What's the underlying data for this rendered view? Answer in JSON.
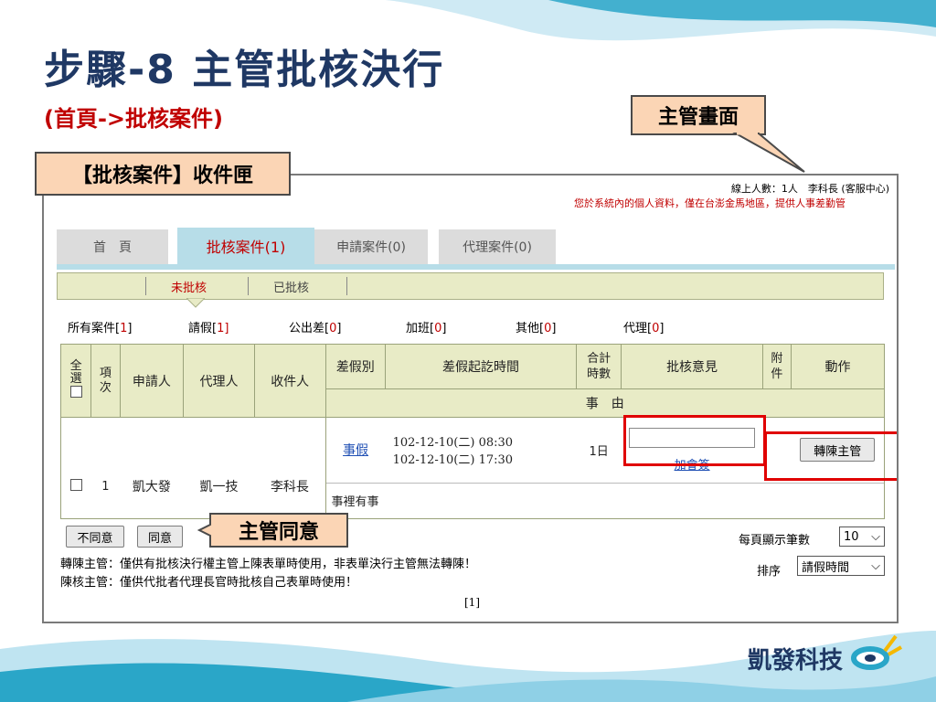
{
  "slide": {
    "title": "步驟-8 主管批核決行",
    "subtitle": "(首頁->批核案件)",
    "callout_manager_screen": "主管畫面",
    "callout_inbox": "【批核案件】收件匣",
    "callout_manager_agree": "主管同意",
    "logo_text": "凱發科技"
  },
  "header": {
    "online_info": "線上人數：1人　李科長 (客服中心)",
    "notice": "您於系統內的個人資料，僅在台澎金馬地區，提供人事差勤管"
  },
  "tabs": [
    {
      "label": "首　頁"
    },
    {
      "label": "批核案件(1)"
    },
    {
      "label": "申請案件(0)"
    },
    {
      "label": "代理案件(0)"
    }
  ],
  "subtabs": {
    "pending": "未批核",
    "approved": "已批核"
  },
  "filters": [
    {
      "label": "所有案件",
      "count": "1"
    },
    {
      "label": "請假",
      "count": "1]"
    },
    {
      "label": "公出差",
      "count": "0"
    },
    {
      "label": "加班",
      "count": "0"
    },
    {
      "label": "其他",
      "count": "0"
    },
    {
      "label": "代理",
      "count": "0"
    }
  ],
  "table": {
    "headers": {
      "select_all": "全選",
      "item_no": "項次",
      "applicant": "申請人",
      "agent": "代理人",
      "recipient": "收件人",
      "leave_type": "差假別",
      "period": "差假起訖時間",
      "total_hours": "合計時數",
      "opinion": "批核意見",
      "attachment": "附件",
      "action": "動作",
      "reason": "事　由"
    },
    "row": {
      "no": "1",
      "applicant": "凱大發",
      "agent": "凱一技",
      "recipient": "李科長",
      "leave_type": "事假",
      "start": "102-12-10(二) 08:30",
      "end": "102-12-10(二) 17:30",
      "total": "1日",
      "opinion_value": "",
      "cosign_link": "加會簽",
      "action_button": "轉陳主管",
      "reason": "事裡有事"
    }
  },
  "footer": {
    "disagree_button": "不同意",
    "agree_button": "同意",
    "per_page_label": "每頁顯示筆數",
    "per_page_value": "10",
    "sort_label": "排序",
    "sort_value": "請假時間",
    "note1": "轉陳主管：僅供有批核決行權主管上陳表單時使用，非表單決行主管無法轉陳！",
    "note2": "陳核主管：僅供代批者代理長官時批核自己表單時使用！",
    "page": "[1]"
  },
  "colors": {
    "title": "#1f3864",
    "subtitle": "#c00000",
    "callout_fill": "#fbd5b5",
    "highlight_box": "#e00000",
    "active_tab": "#b7dde8",
    "grid_header": "#e8ebc6",
    "wave_teal": "#2aa6c8"
  }
}
